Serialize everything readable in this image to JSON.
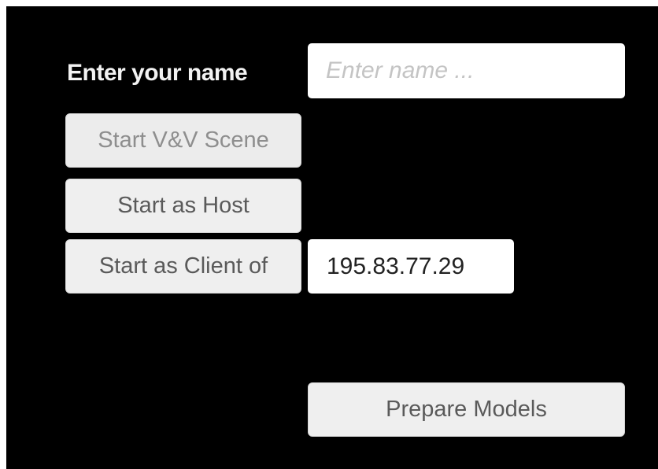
{
  "name_row": {
    "label": "Enter your name",
    "input_placeholder": "Enter name ...",
    "input_value": ""
  },
  "buttons": {
    "start_vv_scene": "Start V&V Scene",
    "start_as_host": "Start as Host",
    "start_as_client_of": "Start as Client of",
    "prepare_models": "Prepare Models"
  },
  "client_row": {
    "ip_value": "195.83.77.29"
  }
}
